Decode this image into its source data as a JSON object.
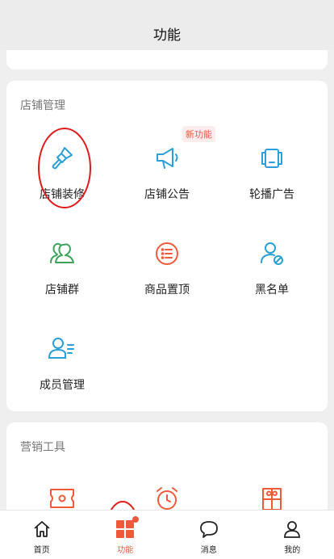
{
  "header": {
    "title": "功能"
  },
  "store_management": {
    "title": "店铺管理",
    "new_badge": "新功能",
    "items": [
      {
        "label": "店铺装修",
        "icon": "paint-brush-icon",
        "color": "#2a9fd8"
      },
      {
        "label": "店铺公告",
        "icon": "megaphone-icon",
        "color": "#2a9fd8"
      },
      {
        "label": "轮播广告",
        "icon": "carousel-icon",
        "color": "#2a9fd8"
      },
      {
        "label": "店铺群",
        "icon": "group-icon",
        "color": "#3da35a"
      },
      {
        "label": "商品置顶",
        "icon": "list-pin-icon",
        "color": "#f05a3a"
      },
      {
        "label": "黑名单",
        "icon": "user-block-icon",
        "color": "#2a9fd8"
      },
      {
        "label": "成员管理",
        "icon": "member-list-icon",
        "color": "#2a9fd8"
      }
    ]
  },
  "marketing_tools": {
    "title": "营销工具",
    "items": [
      {
        "icon": "ticket-icon",
        "color": "#f05a3a"
      },
      {
        "icon": "alarm-clock-icon",
        "color": "#f05a3a"
      },
      {
        "icon": "gift-icon",
        "color": "#f05a3a"
      }
    ]
  },
  "tab_bar": {
    "items": [
      {
        "label": "首页",
        "icon": "home-icon",
        "active": false
      },
      {
        "label": "功能",
        "icon": "grid-icon",
        "active": true
      },
      {
        "label": "消息",
        "icon": "chat-bubble-icon",
        "active": false
      },
      {
        "label": "我的",
        "icon": "person-icon",
        "active": false
      }
    ]
  },
  "colors": {
    "accent": "#f05a3a",
    "blue": "#2a9fd8",
    "green": "#3da35a",
    "annotation": "#e11a1a"
  }
}
